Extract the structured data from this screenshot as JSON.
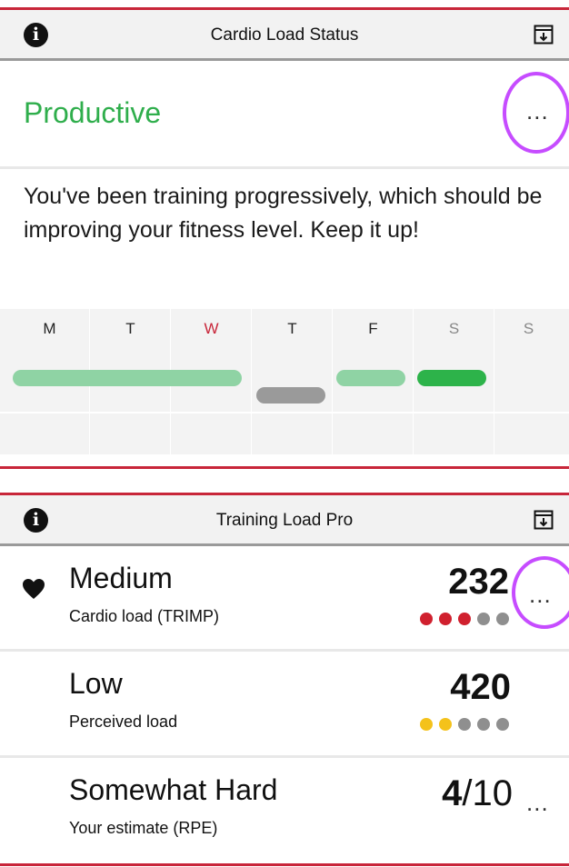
{
  "cardio_panel": {
    "title": "Cardio Load Status",
    "info_icon": "info-icon",
    "export_icon": "export-icon",
    "status": "Productive",
    "status_color": "#2fae4c",
    "more_label": "...",
    "description": "You've been training progressively, which should be improving your fitness level. Keep it up!",
    "week_days": [
      "M",
      "T",
      "W",
      "T",
      "F",
      "S",
      "S"
    ],
    "highlight_day_color": "#c8263a"
  },
  "training_panel": {
    "title": "Training Load Pro",
    "info_icon": "info-icon",
    "export_icon": "export-icon",
    "metrics": [
      {
        "icon": "heart-icon",
        "level": "Medium",
        "label": "Cardio load (TRIMP)",
        "value": "232",
        "denominator": "",
        "rating": 3,
        "rating_max": 5,
        "rating_color": "#d0202e",
        "more_label": "..."
      },
      {
        "level": "Low",
        "label": "Perceived load",
        "value": "420",
        "denominator": "",
        "rating": 2,
        "rating_max": 5,
        "rating_color": "#f4c21b"
      },
      {
        "level": "Somewhat Hard",
        "label": "Your estimate (RPE)",
        "value": "4",
        "denominator": "/10",
        "more_label": "..."
      }
    ]
  },
  "colors": {
    "accent_red": "#c8263a",
    "highlight_ring": "#c64cff",
    "bar_light_green": "#8fd3a4",
    "bar_green": "#2db34a",
    "bar_gray": "#9a9a9a",
    "dot_gray": "#8f8f8f"
  }
}
